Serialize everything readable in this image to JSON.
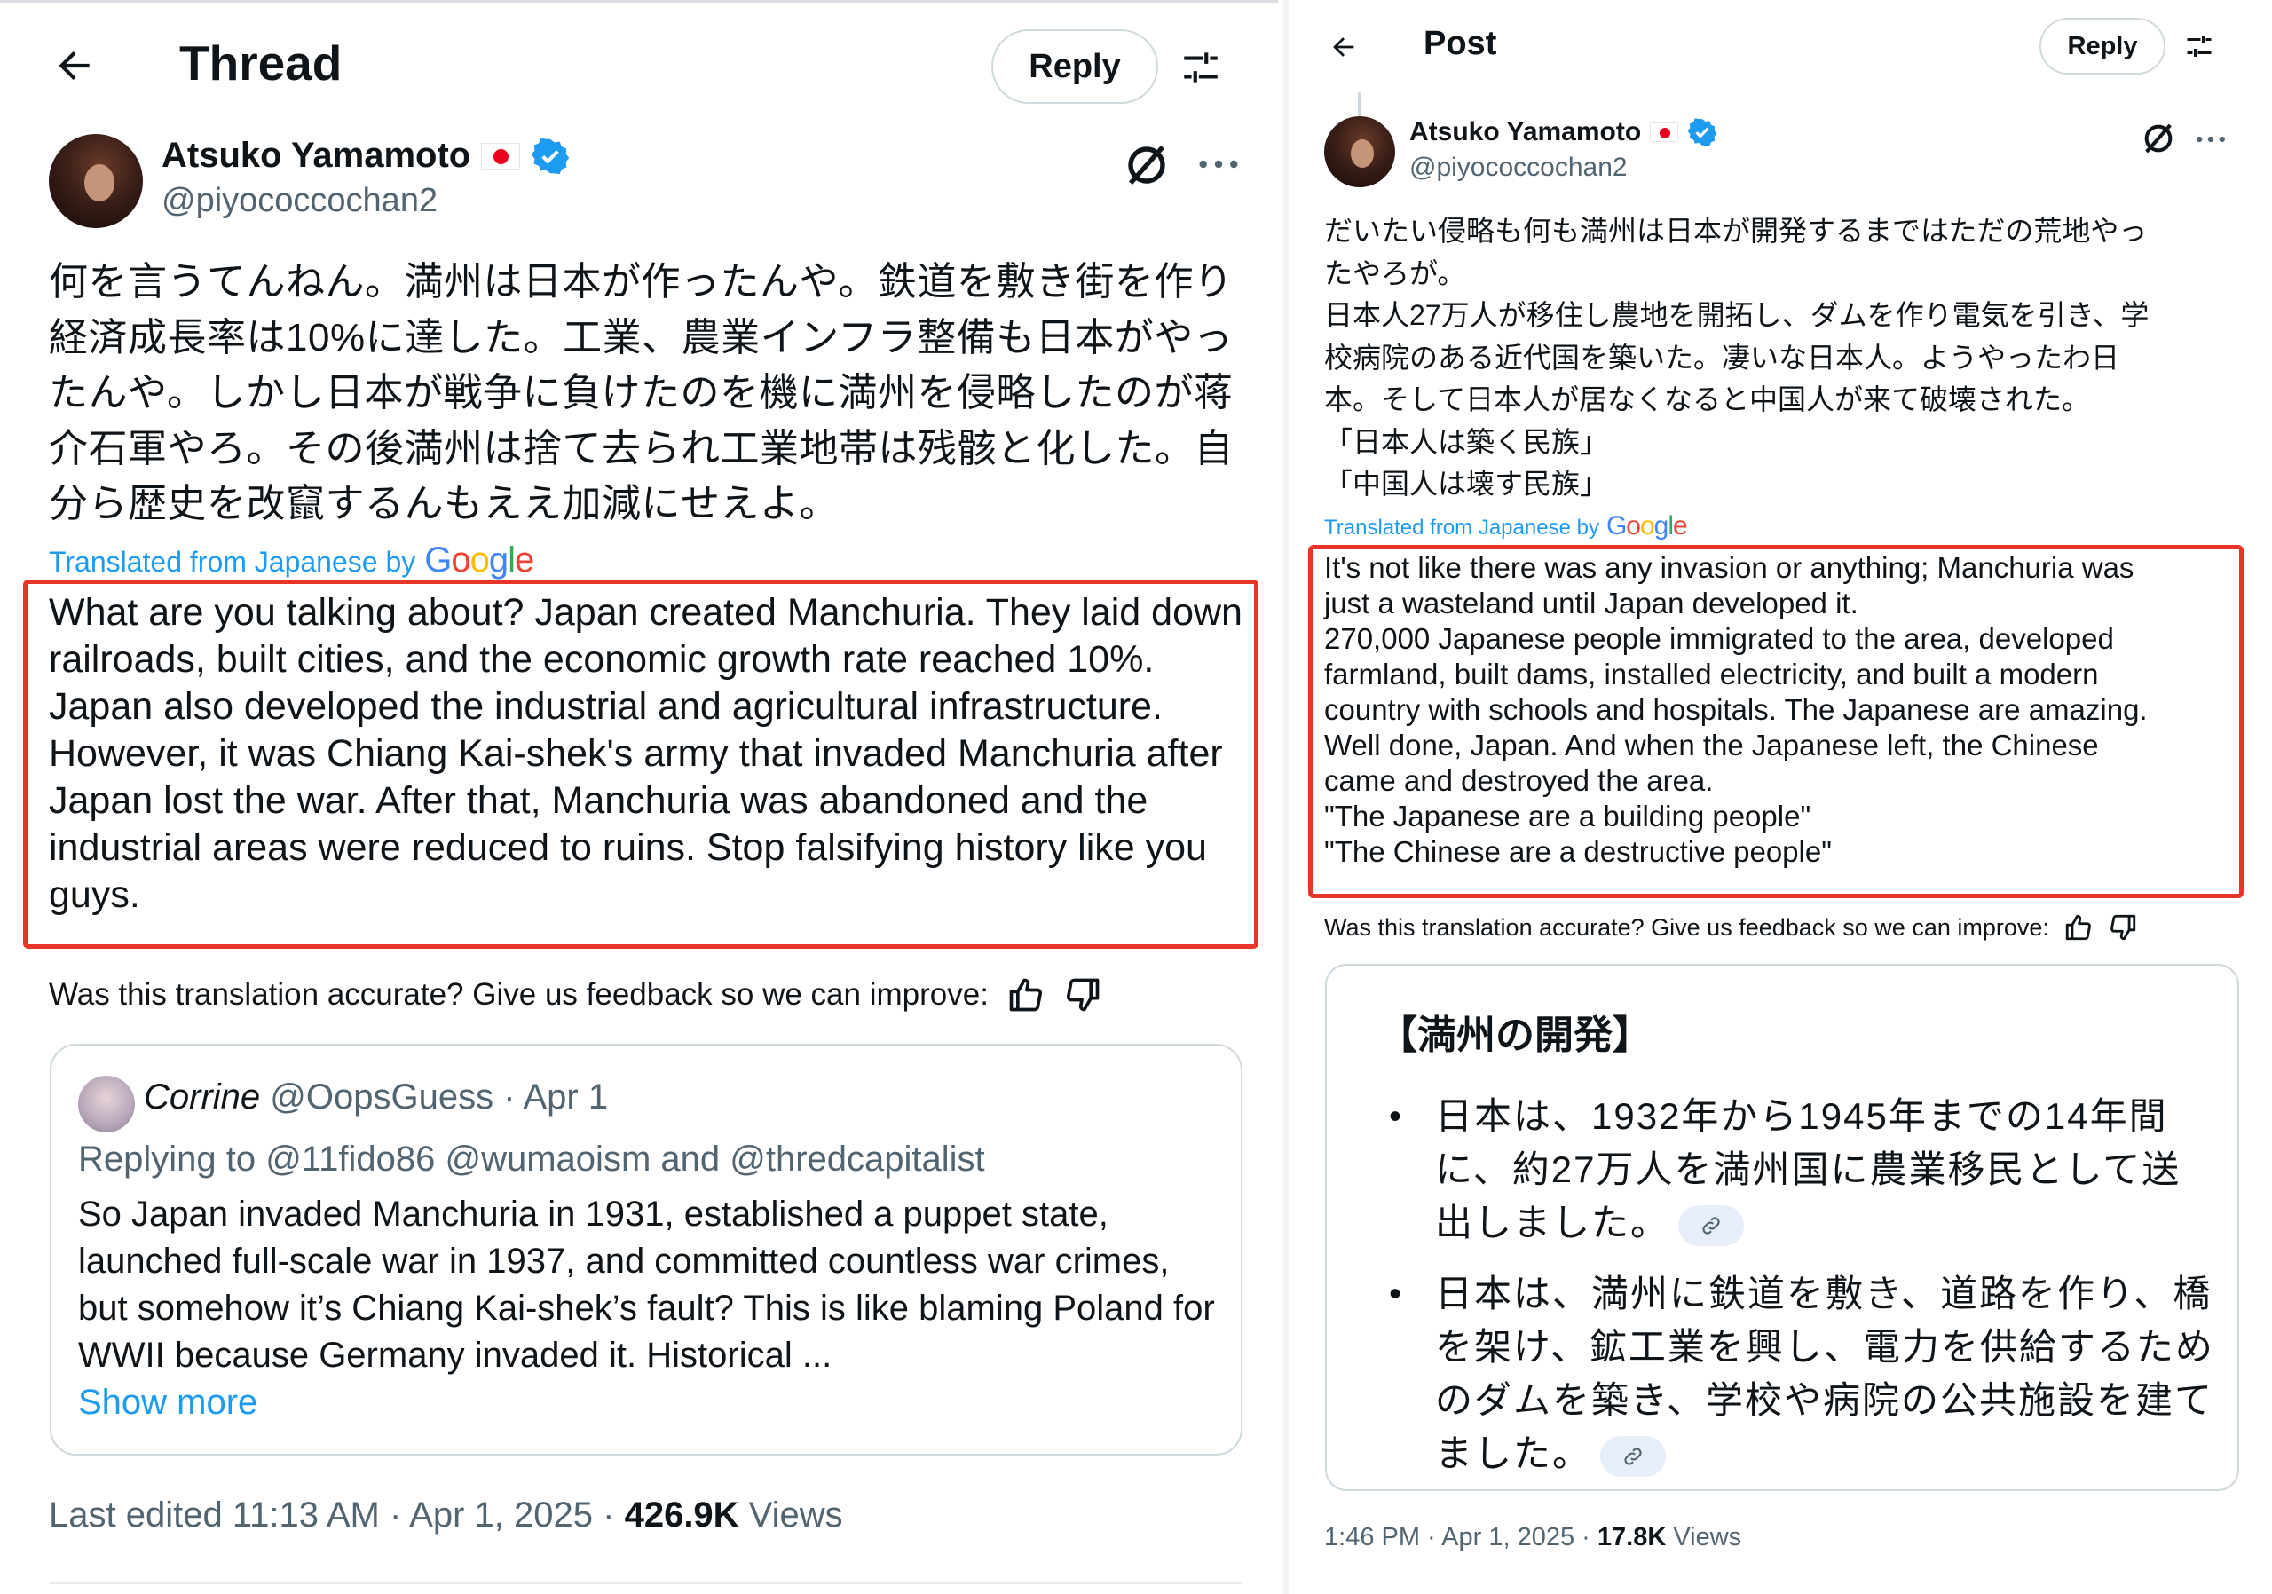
{
  "left": {
    "header": {
      "title": "Thread",
      "reply_label": "Reply"
    },
    "author": {
      "name": "Atsuko Yamamoto",
      "handle": "@piyococcochan2"
    },
    "jp_text": "何を言うてんねん。満州は日本が作ったんや。鉄道を敷き街を作り経済成長率は10%に達した。工業、農業インフラ整備も日本がやったんや。しかし日本が戦争に負けたのを機に満州を侵略したのが蒋介石軍やろ。その後満州は捨て去られ工業地帯は残骸と化した。自分ら歴史を改竄するんもええ加減にせえよ。",
    "translated_by": "Translated from Japanese by",
    "google": [
      "G",
      "o",
      "o",
      "g",
      "l",
      "e"
    ],
    "en_text": "What are you talking about? Japan created Manchuria. They laid down railroads, built cities, and the economic growth rate reached 10%. Japan also developed the industrial and agricultural infrastructure. However, it was Chiang Kai-shek's army that invaded Manchuria after Japan lost the war. After that, Manchuria was abandoned and the industrial areas were reduced to ruins. Stop falsifying history like you guys.",
    "feedback": "Was this translation accurate? Give us feedback so we can improve:",
    "quote": {
      "name": "Corrine",
      "handle": "@OopsGuess",
      "sep": "·",
      "date": "Apr 1",
      "replying_prefix": "Replying to",
      "mention_1": "@11fido86",
      "mention_2": "@wumaoism",
      "and": "and",
      "mention_3": "@thredcapitalist",
      "body": "So Japan invaded Manchuria in 1931, established a puppet state, launched full-scale war in 1937, and committed countless war crimes, but somehow it’s Chiang Kai-shek’s fault? This is like blaming Poland for WWII because Germany invaded it. Historical ...",
      "show_more": "Show more"
    },
    "meta": {
      "edited": "Last edited 11:13 AM · Apr 1, 2025 ·",
      "views_count": "426.9K",
      "views_label": "Views"
    }
  },
  "right": {
    "header": {
      "title": "Post",
      "reply_label": "Reply"
    },
    "author": {
      "name": "Atsuko Yamamoto",
      "handle": "@piyococcochan2"
    },
    "jp_lines": [
      "だいたい侵略も何も満州は日本が開発するまではただの荒地やっ",
      "たやろが。",
      "日本人27万人が移住し農地を開拓し、ダムを作り電気を引き、学",
      "校病院のある近代国を築いた。凄いな日本人。ようやったわ日",
      "本。そして日本人が居なくなると中国人が来て破壊された。",
      "「日本人は築く民族」",
      "「中国人は壊す民族」"
    ],
    "translated_by": "Translated from Japanese by",
    "en_lines": [
      "It's not like there was any invasion or anything; Manchuria was",
      "just a wasteland until Japan developed it.",
      "270,000 Japanese people immigrated to the area, developed",
      "farmland, built dams, installed electricity, and built a modern",
      "country with schools and hospitals. The Japanese are amazing.",
      "Well done, Japan. And when the Japanese left, the Chinese",
      "came and destroyed the area.",
      "\"The Japanese are a building people\"",
      "\"The Chinese are a destructive people\""
    ],
    "feedback": "Was this translation accurate? Give us feedback so we can improve:",
    "card": {
      "title": "【満州の開発】",
      "bullets": [
        "日本は、1932年から1945年までの14年間に、約27万人を満州国に農業移民として送出しました。",
        "日本は、満州に鉄道を敷き、道路を作り、橋を架け、鉱工業を興し、電力を供給するためのダムを築き、学校や病院の公共施設を建てました。"
      ]
    },
    "meta": {
      "time": "1:46 PM · Apr 1, 2025 ·",
      "views_count": "17.8K",
      "views_label": "Views"
    }
  },
  "colors": {
    "accent": "#1d9bf0",
    "highlight": "#e8352a",
    "muted": "#536471",
    "verified": "#1d9bf0"
  },
  "icons": [
    "back-arrow-icon",
    "settings-sliders-icon",
    "grok-icon",
    "more-icon",
    "verified-badge-icon",
    "japan-flag-icon",
    "thumbs-up-icon",
    "thumbs-down-icon",
    "link-icon"
  ]
}
